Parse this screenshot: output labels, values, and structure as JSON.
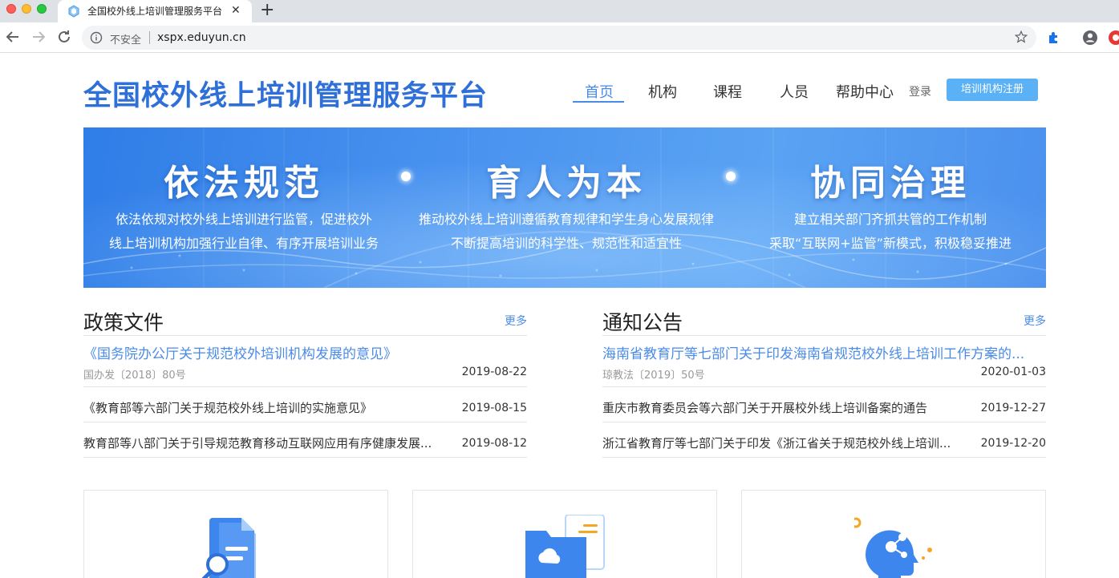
{
  "browser": {
    "tab_title": "全国校外线上培训管理服务平台",
    "tab_close": "✕",
    "new_tab": "+",
    "insecure_label": "不安全",
    "url": "xspx.eduyun.cn"
  },
  "site": {
    "title": "全国校外线上培训管理服务平台",
    "nav": [
      {
        "label": "首页",
        "active": true
      },
      {
        "label": "机构"
      },
      {
        "label": "课程"
      },
      {
        "label": "人员"
      },
      {
        "label": "帮助中心"
      }
    ],
    "login": "登录",
    "register": "培训机构注册"
  },
  "banner": {
    "columns": [
      {
        "heading": "依法规范",
        "lines": [
          "依法依规对校外线上培训进行监管，促进校外",
          "线上培训机构加强行业自律、有序开展培训业务"
        ]
      },
      {
        "heading": "育人为本",
        "lines": [
          "推动校外线上培训遵循教育规律和学生身心发展规律",
          "不断提高培训的科学性、规范性和适宜性"
        ]
      },
      {
        "heading": "协同治理",
        "lines": [
          "建立相关部门齐抓共管的工作机制",
          "采取“互联网+监管”新模式，积极稳妥推进"
        ]
      }
    ]
  },
  "policy": {
    "title": "政策文件",
    "more": "更多",
    "featured": {
      "title": "《国务院办公厅关于规范校外培训机构发展的意见》",
      "sub": "国办发〔2018〕80号",
      "date": "2019-08-22"
    },
    "items": [
      {
        "title": "《教育部等六部门关于规范校外线上培训的实施意见》",
        "date": "2019-08-15"
      },
      {
        "title": "教育部等八部门关于引导规范教育移动互联网应用有序健康发展...",
        "date": "2019-08-12"
      }
    ]
  },
  "notice": {
    "title": "通知公告",
    "more": "更多",
    "featured": {
      "title": "海南省教育厅等七部门关于印发海南省规范校外线上培训工作方案的...",
      "sub": "琼教法〔2019〕50号",
      "date": "2020-01-03"
    },
    "items": [
      {
        "title": "重庆市教育委员会等六部门关于开展校外线上培训备案的通告",
        "date": "2019-12-27"
      },
      {
        "title": "浙江省教育厅等七部门关于印发《浙江省关于规范校外线上培训...",
        "date": "2019-12-20"
      }
    ]
  },
  "cards": [
    {
      "icon": "document-search-icon"
    },
    {
      "icon": "cloud-folder-icon"
    },
    {
      "icon": "ai-head-icon"
    }
  ],
  "colors": {
    "accent": "#4a8be8",
    "brand_title": "#2f6fd8",
    "register": "#5bb1f5"
  }
}
